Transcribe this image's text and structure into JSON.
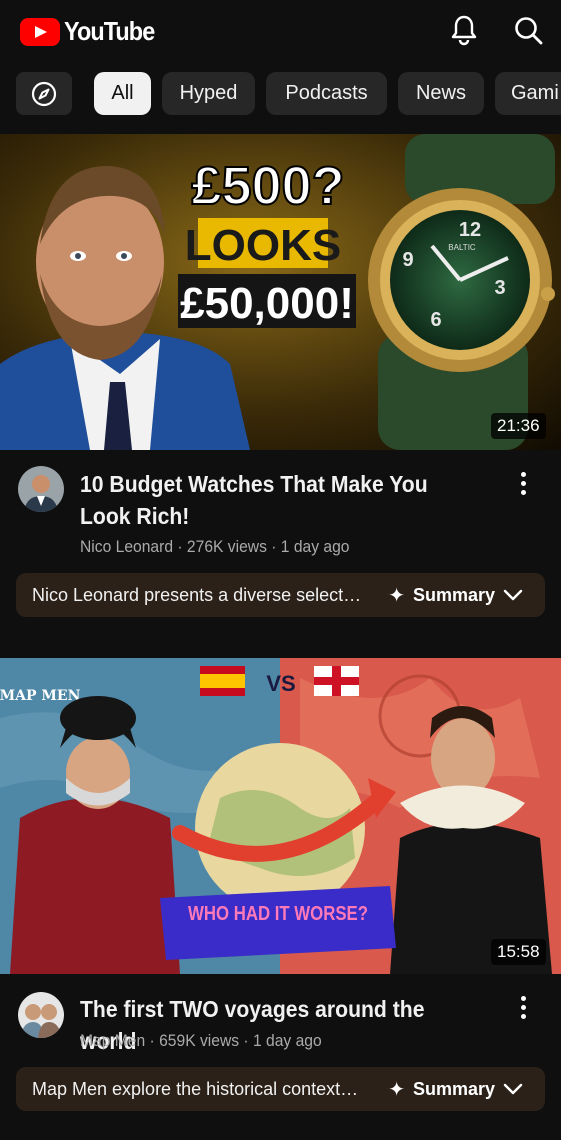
{
  "app": {
    "name": "YouTube"
  },
  "header": {
    "icons": [
      "notifications-icon",
      "search-icon"
    ]
  },
  "chips": [
    {
      "label": "All",
      "active": true
    },
    {
      "label": "Hyped",
      "active": false
    },
    {
      "label": "Podcasts",
      "active": false
    },
    {
      "label": "News",
      "active": false
    },
    {
      "label": "Gami",
      "active": false
    }
  ],
  "videos": [
    {
      "thumbnail_text": {
        "line1": "£500?",
        "line2": "LOOKS",
        "line3": "£50,000!",
        "watch_brand": "BALTIC"
      },
      "duration": "21:36",
      "title": "10 Budget Watches That Make You Look Rich!",
      "meta": "Nico Leonard · 276K views · 1 day ago",
      "summary_text": "Nico Leonard presents a diverse select…",
      "summary_label": "Summary"
    },
    {
      "thumbnail_text": {
        "vs": "VS",
        "banner": "WHO HAD IT WORSE?",
        "logo": "MAP MEN"
      },
      "duration": "15:58",
      "title": "The first TWO voyages around the world",
      "meta": "Map Men · 659K views · 1 day ago",
      "summary_text": "Map Men explore the historical context…",
      "summary_label": "Summary"
    }
  ],
  "colors": {
    "background": "#0f0f0f",
    "chip": "#272727",
    "chip_active": "#f1f1f1",
    "brand_red": "#ff0000",
    "summary_bg": "#2b2119"
  }
}
